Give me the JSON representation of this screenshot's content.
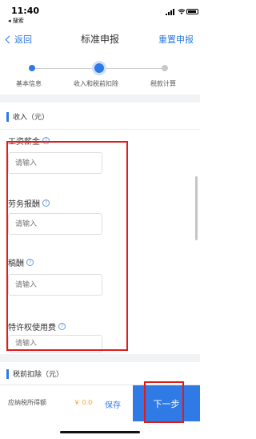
{
  "status": {
    "time": "11:40",
    "back_app": "◂ 搜索"
  },
  "nav": {
    "back": "返回",
    "title": "标准申报",
    "right": "重置申报"
  },
  "steps": [
    {
      "label": "基本信息",
      "state": "done"
    },
    {
      "label": "收入和税前扣除",
      "state": "current"
    },
    {
      "label": "税款计算",
      "state": "todo"
    }
  ],
  "income_section": {
    "title": "收入（元）"
  },
  "fields": [
    {
      "label": "工资薪金",
      "placeholder": "请输入"
    },
    {
      "label": "劳务报酬",
      "placeholder": "请输入"
    },
    {
      "label": "稿酬",
      "placeholder": "请输入"
    },
    {
      "label": "特许权使用费",
      "placeholder": "请输入"
    }
  ],
  "deduction_section": {
    "title": "税前扣除（元）"
  },
  "footer": {
    "tax_label": "应纳税所得额",
    "tax_value": "￥ 0.00",
    "save": "保存",
    "next": "下一步"
  },
  "help_icon": "?",
  "colors": {
    "accent": "#2f7ae5",
    "highlight": "#e01b1b",
    "amount": "#f0a030"
  }
}
